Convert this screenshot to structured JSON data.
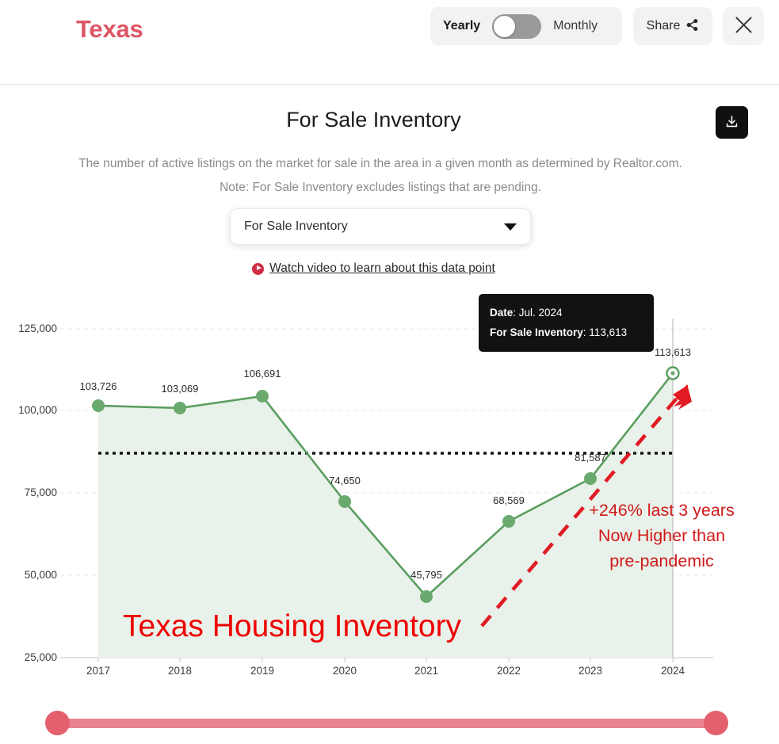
{
  "header": {
    "region_title": "Texas",
    "frequency_toggle": {
      "left_label": "Yearly",
      "right_label": "Monthly",
      "selected": "Yearly"
    },
    "share_label": "Share",
    "share_icon": "share-icon",
    "close_icon": "close-icon"
  },
  "panel": {
    "title": "For Sale Inventory",
    "description": "The number of active listings on the market for sale in the area in a given month as determined by Realtor.com. Note: For Sale Inventory excludes listings that are pending.",
    "download_icon": "download-icon",
    "metric_select": {
      "value": "For Sale Inventory",
      "caret_icon": "chevron-down-icon"
    },
    "video_link": {
      "text": "Watch video to learn about this data point",
      "icon": "play-circle-icon"
    }
  },
  "tooltip": {
    "date_key": "Date",
    "date_value": ": Jul. 2024",
    "metric_key": "For Sale Inventory",
    "metric_value": ": 113,613"
  },
  "annotations": {
    "headline": "Texas Housing Inventory",
    "callout_line1": "+246% last 3 years",
    "callout_line2": "Now Higher than",
    "callout_line3": "pre-pandemic",
    "headline_color": "#ee0000",
    "callout_color": "#d01919",
    "arrow_color": "#e01b24"
  },
  "slider": {
    "left_handle": "range-start-handle",
    "right_handle": "range-end-handle",
    "track_color": "#e8838f"
  },
  "chart_data": {
    "type": "line",
    "title": "For Sale Inventory",
    "xlabel": "",
    "ylabel": "",
    "categories": [
      "2017",
      "2018",
      "2019",
      "2020",
      "2021",
      "2022",
      "2023",
      "2024"
    ],
    "values": [
      103726,
      103069,
      106691,
      74650,
      45795,
      68569,
      81587,
      113613
    ],
    "point_labels": [
      "103,726",
      "103,069",
      "106,691",
      "74,650",
      "45,795",
      "68,569",
      "81,587",
      "113,613"
    ],
    "ylim": [
      25000,
      125000
    ],
    "yticks": [
      125000,
      100000,
      75000,
      50000,
      25000
    ],
    "ytick_labels": [
      "125,000",
      "100,000",
      "75,000",
      "50,000",
      "25,000"
    ],
    "grid": true,
    "legend": false,
    "series_color": "#5a9e5f",
    "area_fill": "#eaf3ea",
    "average_line": {
      "value": 87400,
      "style": "dotted",
      "color": "#111111"
    },
    "highlighted_point": {
      "category": "2024",
      "value": 113613,
      "label": "113,613"
    }
  }
}
